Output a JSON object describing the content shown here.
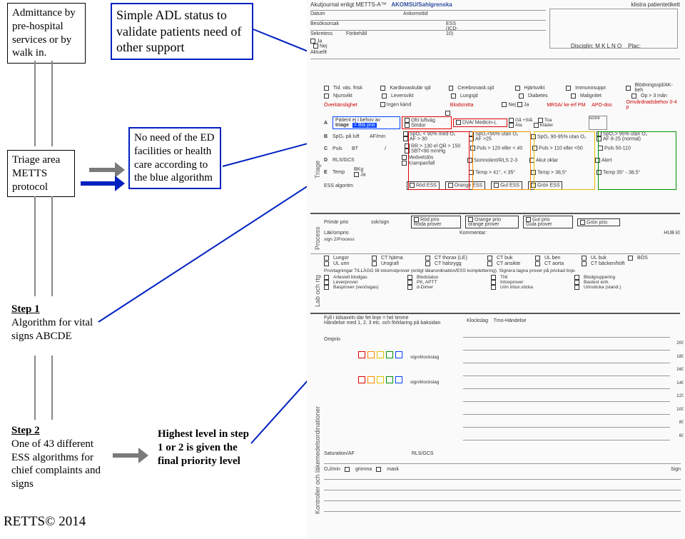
{
  "annotations": {
    "admit": "Admittance by pre-hospital services or by walk in.",
    "adl": "Simple ADL status to validate patients need of other support",
    "triage": "Triage area METTS protocol",
    "ed": "No need of the ED facilities or health care according to the blue algorithm",
    "step1_hdr": "Step 1",
    "step1_body": "Algorithm for vital signs ABCDE",
    "step2_hdr": "Step 2",
    "step2_body": "One of 43 different ESS algorithms for chief complaints and signs",
    "highest": "Highest level in step 1 or 2 is given the final priority level",
    "footer": "RETTS© 2014"
  },
  "form": {
    "header_title": "Akutjournal enligt METTS-A™",
    "header_logo": "AKOMSU/Sahlgrenska",
    "header_note": "klistra patientetikett",
    "datum": "Datum",
    "ankomsttid": "Ankomsttid",
    "besoksorsak": "Besöksorsak",
    "ess": "ESS (ICD-10)",
    "sekretess": "Sekretess",
    "forbehall": "Förbehåll",
    "ja": "Ja",
    "nej": "Nej",
    "aktuellt": "Aktuellt",
    "disciplin": "Disciplin: M  K  L  N  O",
    "plac": "Plac:",
    "hist_items": [
      "Tid. väs. frisk",
      "Kardiovaskulär sjd",
      "Cerebrovask.sjd",
      "Hjärtsvikt",
      "Immunosuppr.",
      "Blödningssjd/AK-beh"
    ],
    "hist_items2": [
      "Njursvikt",
      "Leversvikt",
      "Lungsjd",
      "Diabetes",
      "Malignitet",
      "Op > 3 mån"
    ],
    "overkanslighet": "Överkänslighet",
    "ingen_kand": "Ingen känd",
    "blodsmitta": "Blodsmitta",
    "mrsa": "MRSA/  ke erf PM",
    "apodos": "APO-dos",
    "omvard": "Omvårdnadsbehov 0-4 p",
    "triage_hdr": "Patient ej i behov av",
    "triage_blue": "= Blå prio",
    "triage_word": "triage",
    "spo2": "SpO₂ på luft",
    "afmin": "AF/min",
    "puls": "Puls",
    "bt": "BT",
    "rlsgcs": "RLS/GCS",
    "temp": "Temp",
    "bkg": "BKg",
    "a": "A",
    "b": "B",
    "c": "C",
    "d": "D",
    "e": "E",
    "ofri": "Ofri luftväg",
    "stridor": "Stridor",
    "dva": "DVA/ Medicin-L",
    "ga": "Gå +Stå",
    "ata": "Äta",
    "toa": "Toa",
    "klader": "Kläder",
    "score": "score",
    "spo2_90m": "SpO₂ < 90% med O₂",
    "spo2_90u": "SpO₂<90% utan O₂",
    "spo2_9095": "SpO₂ 90-95% utan O₂",
    "spo2_95": "SpO₂> 95% utan O₂",
    "af30": "AF > 30",
    "af25": "AF >25",
    "af825": "AF 8-25 (normal)",
    "rr130": "RR > 130 el QR > 150",
    "puls120": "Puls > 120 eller < 40",
    "puls110": "Puls > 110 eller <50",
    "puls50110": "Puls 50-110",
    "sbt": "SBT<90 mmHg",
    "medvets": "Medvetslös",
    "somnol": "Somnolent/RLS 2-3",
    "akutoklar": "Akut oklar",
    "alert": "Alert",
    "krampanf": "Krampanfall",
    "temp41": "Temp > 41°, < 35°",
    "temp385": "Temp > 38,5°",
    "temp3538": "Temp 35° - 38,5°",
    "ess_alg": "ESS algoritm",
    "rod_ess": "Röd ESS",
    "orange_ess": "Orange ESS",
    "gul_ess": "Gul ESS",
    "gron_ess": "Grön ESS",
    "primar": "Primär prio",
    "ssk": "ssk/sign",
    "rodprio": "Röd prio",
    "rodprover": "Röda prover",
    "orangeprio": "Orange prio",
    "orangeprover": "orange prover",
    "gulprio": "Gul prio",
    "gulprover": "Gula prover",
    "gronprio": "Grön prio",
    "lakomprio": "Läk/omprio",
    "kommentar": "Kommentar:",
    "hub": "HUB kl:",
    "sign2": "sign 2/Process",
    "imaging": [
      "Lungor",
      "CT hjärna",
      "CT thorax (LE)",
      "CT buk",
      "UL ben",
      "UL buk",
      "BÖS"
    ],
    "imaging2": [
      "UL urin",
      "Urografi",
      "CT halsrygg",
      "CT ansikte",
      "CT aorta",
      "CT bäcken/höft"
    ],
    "provtag": "Provtagningar TILLÄGG till inkomstprover (enligt läkarordination/ESS komplettering). Signera tagna prover på prickad linje.",
    "labs1": [
      "Artesiell blodgas",
      "Blodstatus",
      "TNI",
      "Blodgruppering"
    ],
    "labs2": [
      "Leverprover",
      "PK, APTT",
      "Intoxprover",
      "Bastest           enh."
    ],
    "labs3": [
      "Basprover (venösgas)",
      "d-Dimer",
      "Urin intox.sticka",
      "Urinsticka (stand.)"
    ],
    "timeline": "Fyll i tidsaxeln där fet linje = hel timme",
    "handelse": "Händelse med 1, 2, 3 etc. och förklaring på baksidan",
    "klockslag": "Klockslag",
    "tmo": "Tmo-Händelse",
    "omprio": "Omprio",
    "signk": "sign/klockslag",
    "ticks": [
      "200",
      "180",
      "160",
      "140",
      "120",
      "100",
      "80",
      "60"
    ],
    "sat": "Saturation/AF",
    "rlsgcs2": "RLS/GCS",
    "o2": "O₂l/min",
    "grimma": "grimma",
    "mask": "mask",
    "sign": "Sign",
    "triage_rot": "Triage",
    "process_rot": "Process",
    "labrtg_rot": "Lab och rtg",
    "kontroll_rot": "Kontroller och läkemedelsordinationer"
  }
}
